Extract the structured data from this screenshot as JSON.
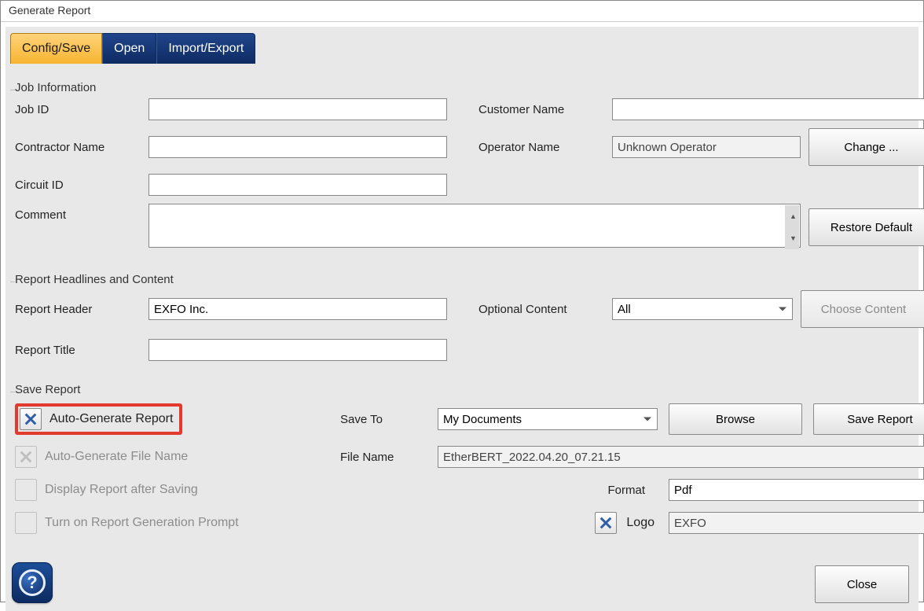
{
  "window": {
    "title": "Generate Report"
  },
  "tabs": {
    "config_save": "Config/Save",
    "open": "Open",
    "import_export": "Import/Export"
  },
  "job_info": {
    "legend": "Job Information",
    "job_id_lbl": "Job ID",
    "job_id_val": "",
    "customer_name_lbl": "Customer Name",
    "customer_name_val": "",
    "contractor_name_lbl": "Contractor Name",
    "contractor_name_val": "",
    "operator_name_lbl": "Operator Name",
    "operator_name_val": "Unknown Operator",
    "change_btn": "Change ...",
    "circuit_id_lbl": "Circuit ID",
    "circuit_id_val": "",
    "comment_lbl": "Comment",
    "comment_val": "",
    "restore_default_btn": "Restore Default"
  },
  "headlines": {
    "legend": "Report Headlines and Content",
    "report_header_lbl": "Report Header",
    "report_header_val": "EXFO Inc.",
    "optional_content_lbl": "Optional Content",
    "optional_content_val": "All",
    "choose_content_btn": "Choose Content",
    "report_title_lbl": "Report Title",
    "report_title_val": ""
  },
  "save": {
    "legend": "Save Report",
    "auto_generate_report_lbl": "Auto-Generate Report",
    "auto_generate_filename_lbl": "Auto-Generate File Name",
    "display_after_saving_lbl": "Display Report after Saving",
    "turn_on_prompt_lbl": "Turn on Report Generation Prompt",
    "save_to_lbl": "Save To",
    "save_to_val": "My Documents",
    "browse_btn": "Browse",
    "save_report_btn": "Save Report",
    "file_name_lbl": "File Name",
    "file_name_val": "EtherBERT_2022.04.20_07.21.15",
    "format_lbl": "Format",
    "format_val": "Pdf",
    "logo_lbl": "Logo",
    "logo_val": "EXFO"
  },
  "footer": {
    "close_btn": "Close"
  }
}
